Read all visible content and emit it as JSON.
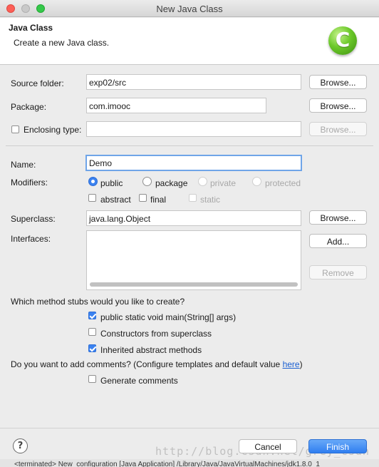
{
  "window": {
    "title": "New Java Class"
  },
  "header": {
    "title": "Java Class",
    "subtitle": "Create a new Java class."
  },
  "source_folder": {
    "label": "Source folder:",
    "value": "exp02/src",
    "browse_label": "Browse..."
  },
  "package": {
    "label": "Package:",
    "value": "com.imooc",
    "browse_label": "Browse..."
  },
  "enclosing_type": {
    "label": "Enclosing type:",
    "checked": false,
    "value": "",
    "browse_label": "Browse..."
  },
  "name": {
    "label": "Name:",
    "value": "Demo"
  },
  "modifiers": {
    "label": "Modifiers:",
    "access": [
      {
        "label": "public",
        "selected": true,
        "enabled": true
      },
      {
        "label": "package",
        "selected": false,
        "enabled": true
      },
      {
        "label": "private",
        "selected": false,
        "enabled": false
      },
      {
        "label": "protected",
        "selected": false,
        "enabled": false
      }
    ],
    "flags": [
      {
        "label": "abstract",
        "checked": false,
        "enabled": true
      },
      {
        "label": "final",
        "checked": false,
        "enabled": true
      },
      {
        "label": "static",
        "checked": false,
        "enabled": false
      }
    ]
  },
  "superclass": {
    "label": "Superclass:",
    "value": "java.lang.Object",
    "browse_label": "Browse..."
  },
  "interfaces": {
    "label": "Interfaces:",
    "items": [],
    "add_label": "Add...",
    "remove_label": "Remove"
  },
  "method_stubs": {
    "question": "Which method stubs would you like to create?",
    "options": [
      {
        "label": "public static void main(String[] args)",
        "checked": true
      },
      {
        "label": "Constructors from superclass",
        "checked": false
      },
      {
        "label": "Inherited abstract methods",
        "checked": true
      }
    ]
  },
  "comments": {
    "question_prefix": "Do you want to add comments? (Configure templates and default value ",
    "link_text": "here",
    "question_suffix": ")",
    "option_label": "Generate comments",
    "checked": false
  },
  "footer": {
    "help_glyph": "?",
    "cancel_label": "Cancel",
    "finish_label": "Finish"
  },
  "watermark": "http://blog.csdn.net/grey_csdn",
  "console_text": "<terminated> New_configuration [Java Application] /Library/Java/JavaVirtualMachines/jdk1.8.0_1",
  "colors": {
    "accent": "#3b82f0",
    "focus_ring": "#6fa5e8",
    "link": "#1a5fd1"
  }
}
